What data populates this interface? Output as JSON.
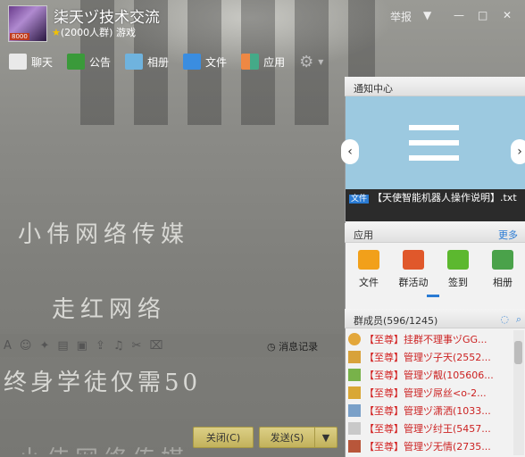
{
  "window": {
    "title": "柒天ヅ技术交流",
    "group_size": "(2000人群)",
    "group_tag": "游戏",
    "avatar_badge": "8000",
    "report": "举报"
  },
  "toolbar": [
    {
      "name": "chat",
      "label": "聊天",
      "icon": "chat-bubble-icon"
    },
    {
      "name": "notice",
      "label": "公告",
      "icon": "megaphone-icon"
    },
    {
      "name": "album",
      "label": "相册",
      "icon": "photo-icon"
    },
    {
      "name": "file",
      "label": "文件",
      "icon": "folder-icon"
    },
    {
      "name": "app",
      "label": "应用",
      "icon": "apps-grid-icon"
    }
  ],
  "chat_bg_text": {
    "line1": "小伟网络传媒",
    "line2": "走红网络",
    "line3": "终身学徒仅需50",
    "line4": "小伟网络传媒"
  },
  "editor": {
    "history": "消息记录"
  },
  "buttons": {
    "close": "关闭(C)",
    "send": "发送(S)"
  },
  "notify": {
    "header": "通知中心",
    "file_badge": "文件",
    "file_name": "【天使智能机器人操作说明】.txt"
  },
  "apps": {
    "header": "应用",
    "more": "更多",
    "items": [
      {
        "label": "文件",
        "color": "#f2a01a"
      },
      {
        "label": "群活动",
        "color": "#e0582b"
      },
      {
        "label": "签到",
        "color": "#5cb82f"
      },
      {
        "label": "相册",
        "color": "#4aa24a"
      }
    ]
  },
  "members": {
    "header": "群成员(596/1245)",
    "list": [
      {
        "level": "【至尊】",
        "name": "挂群不理事ヅGG..."
      },
      {
        "level": "【至尊】",
        "name": "管理ヅ子天(2552..."
      },
      {
        "level": "【至尊】",
        "name": "管理ヅ靓(105606..."
      },
      {
        "level": "【至尊】",
        "name": "管理ヅ屌丝<o-2..."
      },
      {
        "level": "【至尊】",
        "name": "管理ヅ潇洒(1033..."
      },
      {
        "level": "【至尊】",
        "name": "管理ヅ纣王(5457..."
      },
      {
        "level": "【至尊】",
        "name": "管理ヅ无情(2735..."
      }
    ]
  },
  "colors": {
    "accent": "#2a7bd4",
    "level_red": "#d21c1c",
    "send_button": "#c8b864"
  }
}
